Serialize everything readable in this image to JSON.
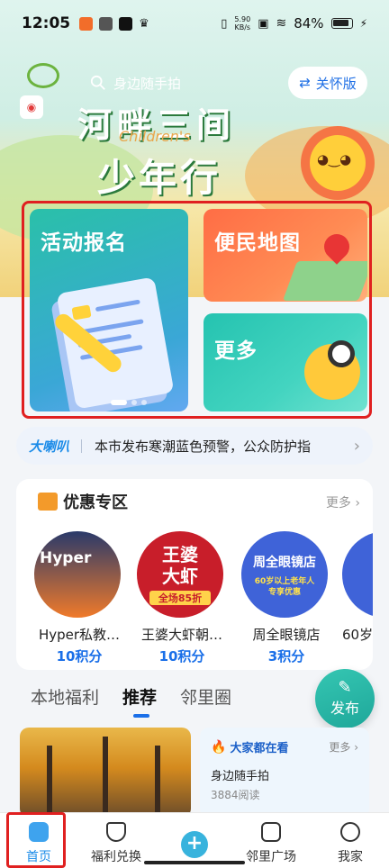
{
  "status_bar": {
    "time": "12:05",
    "net_speed_value": "5.90",
    "net_speed_unit": "KB/s",
    "battery": "84%"
  },
  "header": {
    "search_placeholder": "身边随手拍",
    "care_button": "关怀版"
  },
  "banner": {
    "title_line1": "河畔三间",
    "title_en": "Children's",
    "title_line2": "少年行"
  },
  "quick_entries": [
    {
      "label": "活动报名"
    },
    {
      "label": "便民地图"
    },
    {
      "label": "更多"
    }
  ],
  "notice": {
    "tag": "大喇叭",
    "text": "本市发布寒潮蓝色预警，公众防护指"
  },
  "deals": {
    "title": "优惠专区",
    "more": "更多",
    "items": [
      {
        "name": "Hyper私教…",
        "points": "10积分",
        "image_text": "Hyper"
      },
      {
        "name": "王婆大虾朝…",
        "points": "10积分",
        "image_text": "王婆\n大虾",
        "image_badge": "全场85折"
      },
      {
        "name": "周全眼镜店",
        "points": "3积分",
        "image_text": "周全眼镜店",
        "image_badge": "60岁以上老年人\n专享优惠"
      },
      {
        "name": "60岁",
        "points": "",
        "image_text": ""
      }
    ]
  },
  "tabs": [
    {
      "label": "本地福利"
    },
    {
      "label": "推荐"
    },
    {
      "label": "邻里圈"
    }
  ],
  "publish_button": "发布",
  "trending": {
    "title": "大家都在看",
    "more": "更多",
    "item_title": "身边随手拍",
    "item_reads": "3884阅读"
  },
  "bottom_nav": [
    {
      "label": "首页"
    },
    {
      "label": "福利兑换"
    },
    {
      "label": "邻里广场"
    },
    {
      "label": "我家"
    }
  ],
  "colors": {
    "accent": "#1a6fe8",
    "highlight": "#e02020",
    "teal": "#2ac0a9",
    "orange": "#ff6d45"
  }
}
